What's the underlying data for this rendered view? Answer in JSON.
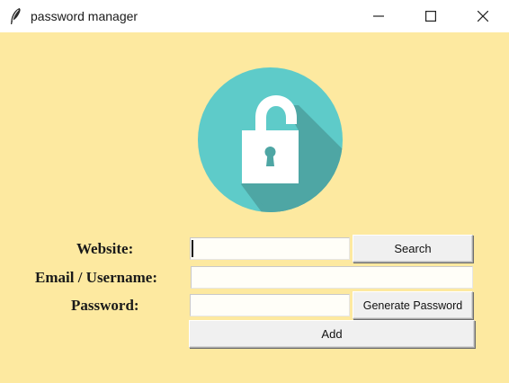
{
  "window": {
    "title": "password manager",
    "controls": [
      "minimize",
      "maximize",
      "close"
    ]
  },
  "logo": {
    "icon": "unlocked-padlock-icon",
    "colors": {
      "circle": "#5ecbc9",
      "shadow": "#4ea6a4",
      "lock": "#ffffff",
      "keyhole": "#4ea6a4"
    }
  },
  "form": {
    "website_label": "Website:",
    "website_value": "",
    "email_label": "Email / Username:",
    "email_value": "",
    "password_label": "Password:",
    "password_value": "",
    "search_label": "Search",
    "generate_label": "Generate Password",
    "add_label": "Add"
  },
  "colors": {
    "background": "#fde9a0",
    "titlebar": "#ffffff",
    "button": "#f0f0f0"
  }
}
